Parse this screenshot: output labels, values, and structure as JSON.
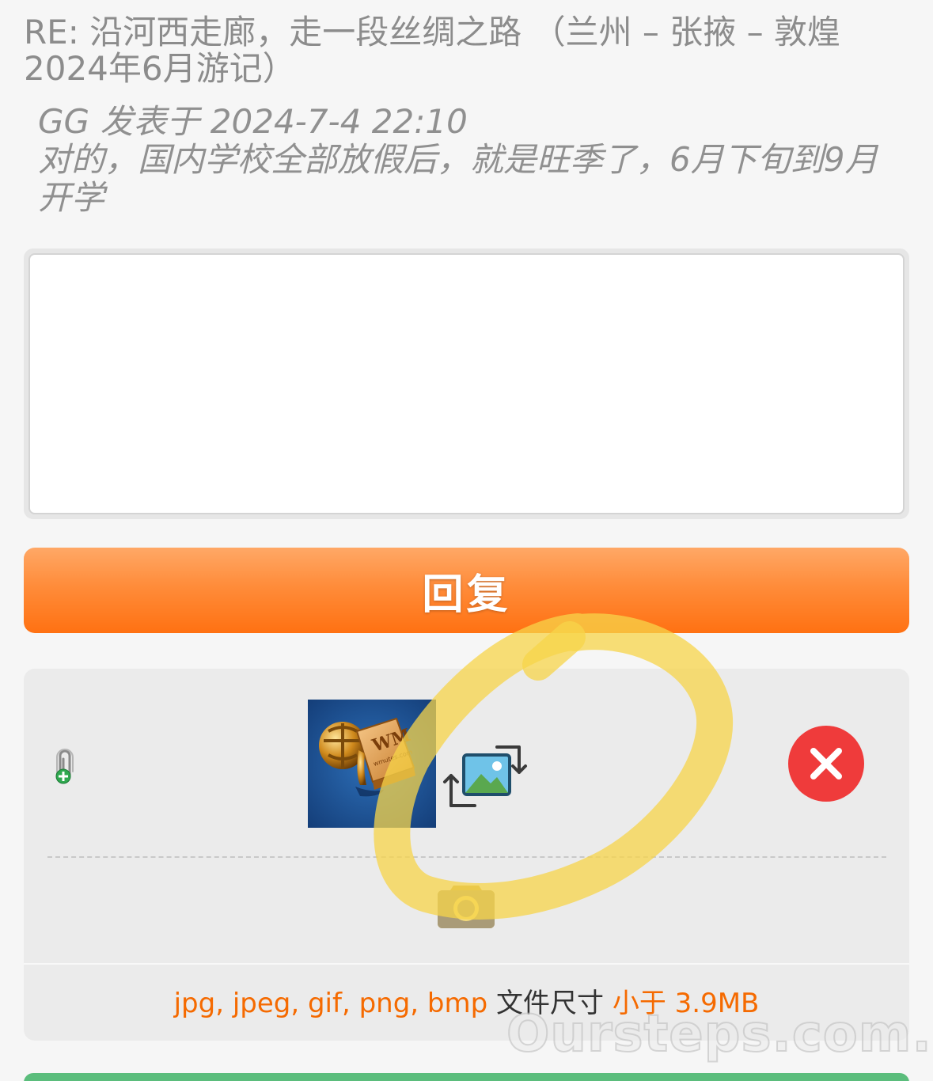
{
  "thread": {
    "title": "RE: 沿河西走廊，走一段丝绸之路 （兰州 – 张掖 – 敦煌 2024年6月游记）"
  },
  "quote": {
    "meta": "GG 发表于 2024-7-4 22:10",
    "body": "对的，国内学校全部放假后，就是旺季了，6月下旬到9月开学"
  },
  "reply_box": {
    "value": "",
    "placeholder": ""
  },
  "reply_button": {
    "label": "回复"
  },
  "upload": {
    "attach_icon": "attachment-add-icon",
    "thumbnail_icon": "wmutes-logo-thumbnail",
    "replace_icon": "replace-image-icon",
    "delete_icon": "close-icon",
    "camera_icon": "camera-icon",
    "hint": {
      "formats": "jpg, jpeg, gif, png, bmp",
      "size_label": "文件尺寸",
      "size_limit": "小于 3.9MB"
    }
  },
  "watermark": {
    "text": "Oursteps.com.au"
  },
  "colors": {
    "accent_orange": "#ff7a1e",
    "delete_red": "#ef3b3b",
    "hint_orange": "#f56a00",
    "highlight_yellow": "#f7d44a",
    "next_button_green": "#5bbd7c"
  }
}
